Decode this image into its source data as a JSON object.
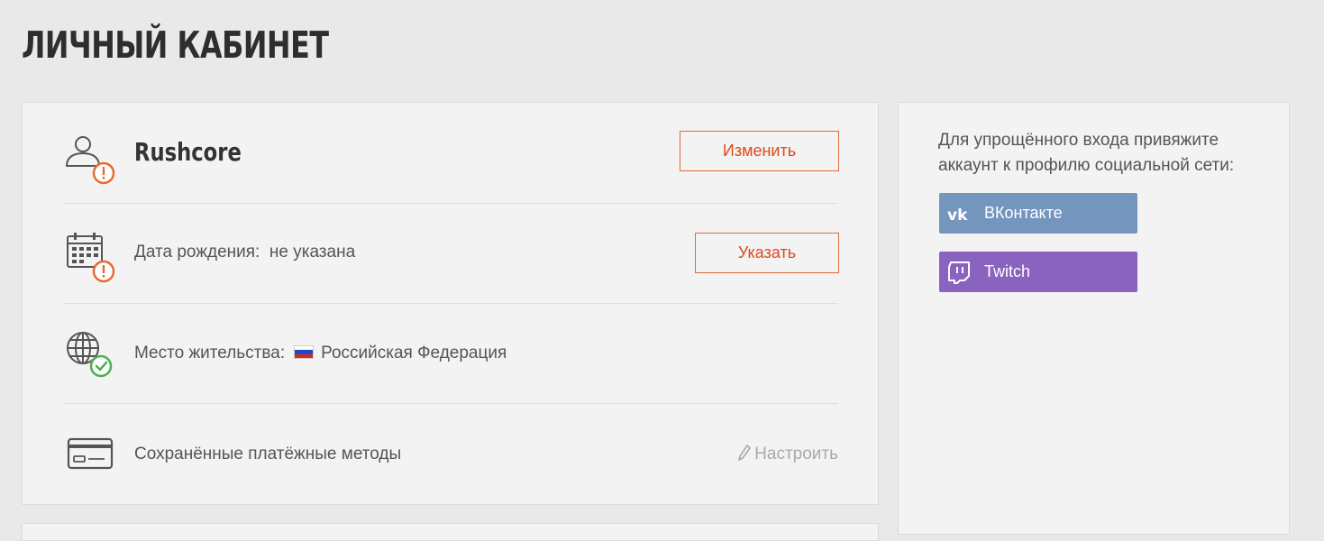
{
  "page": {
    "title": "ЛИЧНЫЙ КАБИНЕТ"
  },
  "profile": {
    "username": "Rushcore",
    "edit_button": "Изменить",
    "birth_label": "Дата рождения:",
    "birth_value": "не указана",
    "birth_button": "Указать",
    "residence_label": "Место жительства:",
    "residence_value": "Российская Федерация",
    "payment_label": "Сохранённые платёжные методы",
    "payment_link": "Настроить"
  },
  "social": {
    "intro": "Для упрощённого входа привяжите аккаунт к профилю социальной сети:",
    "buttons": [
      {
        "label": "ВКонтакте",
        "icon": "vk-icon",
        "color": "#7395be"
      },
      {
        "label": "Twitch",
        "icon": "twitch-icon",
        "color": "#8a63c0"
      }
    ]
  },
  "colors": {
    "accent": "#dd4a1a",
    "warning": "#e96a2f",
    "ok": "#4caf50",
    "background": "#e9e9e9"
  }
}
